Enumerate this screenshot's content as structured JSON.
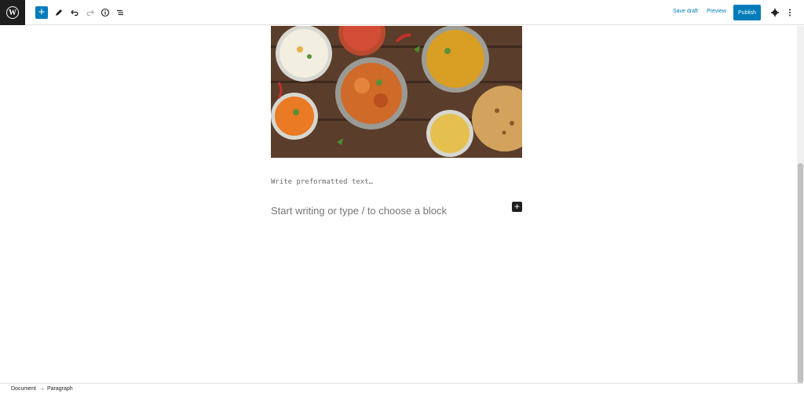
{
  "toolbar": {
    "logo_icon": "wordpress-logo",
    "add_icon": "plus-icon",
    "save_draft_label": "Save draft",
    "preview_label": "Preview",
    "publish_label": "Publish",
    "accent_color": "#007cba"
  },
  "editor": {
    "image_description": "Indian food dishes on wooden table",
    "preformatted_placeholder": "Write preformatted text…",
    "paragraph_placeholder": "Start writing or type / to choose a block"
  },
  "breadcrumb": {
    "items": [
      "Document",
      "→",
      "Paragraph"
    ]
  }
}
